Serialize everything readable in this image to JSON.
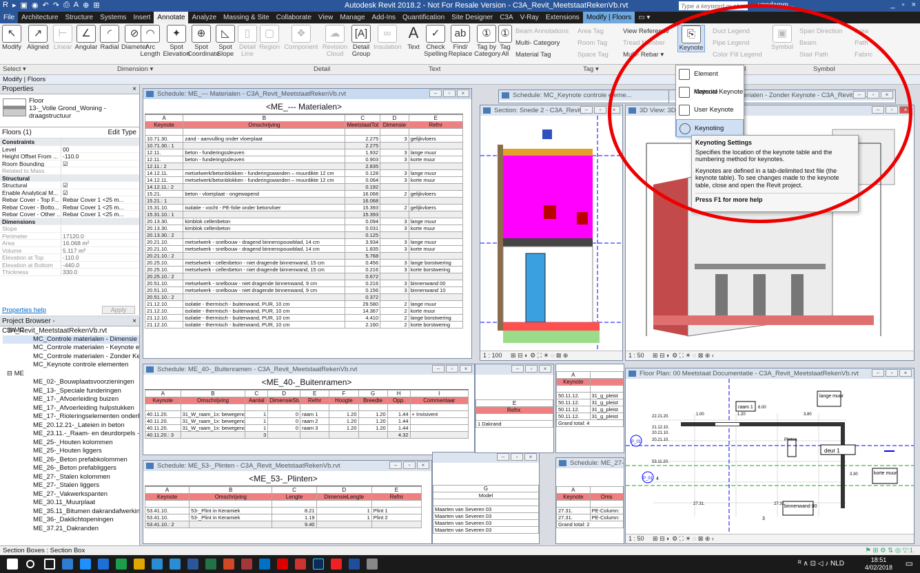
{
  "titlebar": {
    "title": "Autodesk Revit 2018.2 - Not For Resale Version -   C3A_Revit_MeetstaatRekenVb.rvt",
    "search_placeholder": "Type a keyword or phrase",
    "user": "vandamm...",
    "min": "_",
    "restore": "▫",
    "close": "×"
  },
  "tabs": [
    "File",
    "Architecture",
    "Structure",
    "Systems",
    "Insert",
    "Annotate",
    "Analyze",
    "Massing & Site",
    "Collaborate",
    "View",
    "Manage",
    "Add-Ins",
    "Quantification",
    "Site Designer",
    "C3A",
    "V-Ray",
    "Extensions",
    "Modify | Floors",
    "▭ ▾"
  ],
  "ribbon": {
    "modify": "Modify",
    "aligned": "Aligned",
    "linear": "Linear",
    "angular": "Angular",
    "radial": "Radial",
    "diameter": "Diameter",
    "arc_length": "Arc Length",
    "spot_elevation": "Spot Elevation",
    "spot_coordinate": "Spot Coordinate",
    "spot_slope": "Spot Slope",
    "detail_line": "Detail Line",
    "region": "Region",
    "component": "Component",
    "revision_cloud": "Revision Cloud",
    "detail_group": "Detail Group",
    "insulation": "Insulation",
    "text": "Text",
    "check_spelling": "Check Spelling",
    "find_replace": "Find/ Replace",
    "tag_by_category": "Tag by Category",
    "tag_all": "Tag All",
    "beam_annotations": "Beam Annotations",
    "multi_category": "Multi- Category",
    "material_tag": "Material Tag",
    "area_tag": "Area Tag",
    "room_tag": "Room Tag",
    "space_tag": "Space Tag",
    "view_reference": "View Reference",
    "tread_number": "Tread Number",
    "multi_rebar": "Multi- Rebar ▾",
    "keynote": "Keynote",
    "duct_legend": "Duct Legend",
    "pipe_legend": "Pipe Legend",
    "color_fill_legend": "Color Fill Legend",
    "symbol": "Symbol",
    "span_direction": "Span Direction",
    "beam": "Beam",
    "stair_path": "Stair Path",
    "area": "Area",
    "path": "Path",
    "fabric": "Fabric"
  },
  "ribbon_footer": {
    "select": "Select ▾",
    "dimension": "Dimension ▾",
    "detail": "Detail",
    "text": "Text",
    "tag": "Tag ▾",
    "fill": "ll",
    "symbol": "Symbol"
  },
  "context": "Modify | Floors",
  "properties": {
    "title": "Properties",
    "type_name": "Floor\n13-_Volle Grond_Woning - draagstructuur",
    "filter": "Floors (1)",
    "edit_type": "Edit Type",
    "rows": [
      {
        "k": "Constraints",
        "v": "",
        "g": true
      },
      {
        "k": "Level",
        "v": "00"
      },
      {
        "k": "Height Offset From ...",
        "v": "-110.0"
      },
      {
        "k": "Room Bounding",
        "v": "☑"
      },
      {
        "k": "Related to Mass",
        "v": "",
        "d": true
      },
      {
        "k": "Structural",
        "v": "",
        "g": true
      },
      {
        "k": "Structural",
        "v": "☑"
      },
      {
        "k": "Enable Analytical M...",
        "v": "☑"
      },
      {
        "k": "Rebar Cover - Top F...",
        "v": "Rebar Cover 1 <25 m..."
      },
      {
        "k": "Rebar Cover - Botto...",
        "v": "Rebar Cover 1 <25 m..."
      },
      {
        "k": "Rebar Cover - Other ...",
        "v": "Rebar Cover 1 <25 m..."
      },
      {
        "k": "Dimensions",
        "v": "",
        "g": true
      },
      {
        "k": "Slope",
        "v": "",
        "d": true
      },
      {
        "k": "Perimeter",
        "v": "17120.0",
        "d": true
      },
      {
        "k": "Area",
        "v": "16.068 m²",
        "d": true
      },
      {
        "k": "Volume",
        "v": "5.117 m³",
        "d": true
      },
      {
        "k": "Elevation at Top",
        "v": "-110.0",
        "d": true
      },
      {
        "k": "Elevation at Bottom",
        "v": "-440.0",
        "d": true
      },
      {
        "k": "Thickness",
        "v": "330.0",
        "d": true
      }
    ],
    "help": "Properties help",
    "apply": "Apply"
  },
  "browser": {
    "title": "Project Browser - C3A_Revit_MeetstaatRekenVb.rvt",
    "items": [
      {
        "t": "⊟ MC",
        "l": 1
      },
      {
        "t": "MC_Controle materialen - Dimensie",
        "l": 2,
        "sel": true
      },
      {
        "t": "MC_Controle materialen - Keynote en",
        "l": 2
      },
      {
        "t": "MC_Controle materialen - Zonder Keyr",
        "l": 2
      },
      {
        "t": "MC_Keynote controle elementen",
        "l": 2
      },
      {
        "t": "⊟ ME",
        "l": 1
      },
      {
        "t": "ME_02-_Bouwplaatsvoorzieningen",
        "l": 2
      },
      {
        "t": "ME_13-_Speciale funderingen",
        "l": 2
      },
      {
        "t": "ME_17-_Afvoerleiding buizen",
        "l": 2
      },
      {
        "t": "ME_17-_Afvoerleiding hulpstukken",
        "l": 2
      },
      {
        "t": "ME_17-_Rioleringselementen onderbo",
        "l": 2
      },
      {
        "t": "ME_20.12.21-_Lateien in beton",
        "l": 2
      },
      {
        "t": "ME_23.11.-_Raam- en deurdorpels - b",
        "l": 2
      },
      {
        "t": "ME_25-_Houten kolommen",
        "l": 2
      },
      {
        "t": "ME_25-_Houten liggers",
        "l": 2
      },
      {
        "t": "ME_26-_Beton prefabkolommen",
        "l": 2
      },
      {
        "t": "ME_26-_Beton prefabliggers",
        "l": 2
      },
      {
        "t": "ME_27-_Stalen kolommen",
        "l": 2
      },
      {
        "t": "ME_27-_Stalen liggers",
        "l": 2
      },
      {
        "t": "ME_27-_Vakwerkspanten",
        "l": 2
      },
      {
        "t": "ME_30.11_Muurplaat",
        "l": 2
      },
      {
        "t": "ME_35.11_Bitumen dakrandafwerkin",
        "l": 2
      },
      {
        "t": "ME_36-_Daklichtopeningen",
        "l": 2
      },
      {
        "t": "ME_37.21_Dakranden",
        "l": 2
      }
    ]
  },
  "sched_mat": {
    "tab": "Schedule: ME_--- Materialen - C3A_Revit_MeetstaatRekenVb.rvt",
    "title": "<ME_--- Materialen>",
    "letters": [
      "A",
      "B",
      "C",
      "D",
      "E"
    ],
    "headers": [
      "Keynote",
      "Omschrijving",
      "MeetstaatTot",
      "Dimensie",
      "Refnr"
    ],
    "rows": [
      [
        "",
        "",
        "",
        "",
        ""
      ],
      [
        "10.71.30.",
        "zand - aanvulling onder vloerplaat",
        "2.275",
        "3",
        "gelijkvloers"
      ],
      [
        "10.71.30.: 1",
        "",
        "2.275",
        "",
        ""
      ],
      [
        "12.11.",
        "beton - funderingssleuven",
        "1.932",
        "3",
        "lange muur"
      ],
      [
        "12.11.",
        "beton - funderingssleuven",
        "0.903",
        "3",
        "korte muur"
      ],
      [
        "12.11.: 2",
        "",
        "2.835",
        "",
        ""
      ],
      [
        "14.12.11.",
        "metselwerk/betonblokken - funderingswanden – muurdikte 12 cm",
        "0.128",
        "3",
        "lange muur"
      ],
      [
        "14.12.11.",
        "metselwerk/betonblokken - funderingswanden – muurdikte 12 cm",
        "0.064",
        "3",
        "korte muur"
      ],
      [
        "14.12.11.: 2",
        "",
        "0.192",
        "",
        ""
      ],
      [
        "15.21.",
        "beton - vloerplaat - ongewapend",
        "16.068",
        "2",
        "gelijkvloers"
      ],
      [
        "15.21.: 1",
        "",
        "16.068",
        "",
        ""
      ],
      [
        "15.31.10.",
        "isolatie - vocht - PE-folie onder betonvloer",
        "15.393",
        "2",
        "gelijkvloers"
      ],
      [
        "15.31.10.: 1",
        "",
        "15.393",
        "",
        ""
      ],
      [
        "20.13.30.",
        "kimblok cellenbeton",
        "0.094",
        "3",
        "lange muur"
      ],
      [
        "20.13.30.",
        "kimblok cellenbeton",
        "0.031",
        "3",
        "korte muur"
      ],
      [
        "20.13.30.: 2",
        "",
        "0.125",
        "",
        ""
      ],
      [
        "20.21.10.",
        "metselwerk - snelbouw - dragend binnenspouwblad, 14 cm",
        "3.934",
        "3",
        "lange muur"
      ],
      [
        "20.21.10.",
        "metselwerk - snelbouw - dragend binnenspouwblad, 14 cm",
        "1.835",
        "3",
        "korte muur"
      ],
      [
        "20.21.10.: 2",
        "",
        "5.768",
        "",
        ""
      ],
      [
        "20.25.10.",
        "metselwerk - cellenbeton - niet dragende binnenwand, 15 cm",
        "0.456",
        "3",
        "lange borstwering"
      ],
      [
        "20.25.10.",
        "metselwerk - cellenbeton - niet dragende binnenwand, 15 cm",
        "0.216",
        "3",
        "korte borstwering"
      ],
      [
        "20.25.10.: 2",
        "",
        "0.672",
        "",
        ""
      ],
      [
        "20.51.10.",
        "metselwerk - snelbouw - niet dragende binnenwand, 9 cm",
        "0.216",
        "3",
        "binnenwand 00"
      ],
      [
        "20.51.10.",
        "metselwerk - snelbouw - niet dragende binnenwand, 9 cm",
        "0.156",
        "3",
        "binnenwand 10"
      ],
      [
        "20.51.10.: 2",
        "",
        "0.372",
        "",
        ""
      ],
      [
        "21.12.10.",
        "isolatie - thermisch - buitenwand, PUR, 10 cm",
        "29.580",
        "2",
        "lange muur"
      ],
      [
        "21.12.10.",
        "isolatie - thermisch - buitenwand, PUR, 10 cm",
        "14.367",
        "2",
        "korte muur"
      ],
      [
        "21.12.10.",
        "isolatie - thermisch - buitenwand, PUR, 10 cm",
        "4.410",
        "2",
        "lange borstwering"
      ],
      [
        "21.12.10.",
        "isolatie - thermisch - buitenwand, PUR, 10 cm",
        "2.160",
        "2",
        "korte borstwering"
      ]
    ]
  },
  "sched_ramen": {
    "tab": "Schedule: ME_40-_Buitenramen - C3A_Revit_MeetstaatRekenVb.rvt",
    "title": "<ME_40-_Buitenramen>",
    "letters": [
      "A",
      "B",
      "C",
      "D",
      "E",
      "F",
      "G",
      "H",
      "I"
    ],
    "headers": [
      "Keynote",
      "Omschrijving",
      "Aantal",
      "DimensieStuk",
      "Refnr",
      "Hoogte",
      "Breedte",
      "Opp.",
      "Commentaar"
    ],
    "rows": [
      [
        "",
        "",
        "",
        "",
        "",
        "",
        "",
        "",
        ""
      ],
      [
        "40.11.20.",
        "31_W_raam_1x: bewegend",
        "1",
        "0",
        "raam 1",
        "1.20",
        "1.20",
        "1.44",
        "+ Invisivent"
      ],
      [
        "40.11.20.",
        "31_W_raam_1x: bewegend",
        "1",
        "0",
        "raam 2",
        "1.20",
        "1.20",
        "1.44",
        ""
      ],
      [
        "40.11.20.",
        "31_W_raam_1x: bewegend",
        "1",
        "0",
        "raam 3",
        "1.20",
        "1.20",
        "1.44",
        ""
      ],
      [
        "40.11.20.: 3",
        "",
        "3",
        "",
        "",
        "",
        "",
        "4.32",
        ""
      ]
    ]
  },
  "sched_plint": {
    "tab": "Schedule: ME_53-_Plinten - C3A_Revit_MeetstaatRekenVb.rvt",
    "title": "<ME_53-_Plinten>",
    "letters": [
      "A",
      "B",
      "C",
      "D",
      "E"
    ],
    "headers": [
      "Keynote",
      "Omschrijving",
      "Lengte",
      "DimensieLengte",
      "Refnr"
    ],
    "rows": [
      [
        "",
        "",
        "",
        "",
        ""
      ],
      [
        "53.41.10.",
        "53-_Plint in Keramiek",
        "8.21",
        "1",
        "Plint 1"
      ],
      [
        "53.41.10.",
        "53-_Plint in Keramiek",
        "1.19",
        "1",
        "Plint 2"
      ],
      [
        "53.41.10.: 2",
        "",
        "9.40",
        "",
        ""
      ]
    ]
  },
  "section": {
    "tab": "Section: Snede 2 - C3A_Revit_...",
    "scale": "1 : 100"
  },
  "view3d": {
    "tab": "3D View: 3D Bin...staatRekenVb.rvt",
    "scale": "1 : 50"
  },
  "keynote_sched": {
    "tab": "Schedule: MC_Keynote controle eleme..."
  },
  "zonder": {
    "tab": "aterialen - Zonder Keynote - C3A_Revit_Me..."
  },
  "floorplan": {
    "tab": "Floor Plan: 00 Meetstaat Documentatie - C3A_Revit_MeetstaatRekenVb.rvt",
    "scale": "1 : 50",
    "labels": {
      "raam": "raam 1",
      "lange": "lange muur",
      "korte": "korte muur",
      "deur": "deur 1",
      "plinten": "Plinten",
      "binnen": "binnenwand 00",
      "l1": "22.21.20.",
      "l2": "21.12.10.",
      "l3": "20.21.10.",
      "l4": "53.11.20.",
      "l5": "27.31.",
      "l6": "27.31.",
      "d1": "1.00",
      "d2": "1.20",
      "d3": "3.80",
      "d4": "6.00",
      "d5": "3.30",
      "p1": "P_01",
      "p2": "P_01",
      "n4": "4",
      "n3": "3"
    }
  },
  "mid_sched": {
    "letters": [
      "A",
      "E"
    ],
    "keynote": "Keynote",
    "refnr": "Refnr.",
    "dakrand": "1 Dakrand",
    "rows": [
      [
        "50.11.12.",
        "31_g_pleist"
      ],
      [
        "50.11.12.",
        "31_g_pleist"
      ],
      [
        "50.11.12.",
        "31_g_pleist"
      ],
      [
        "50.11.12.",
        "31_g_pleist"
      ]
    ],
    "total": "Grand total: 4"
  },
  "model_sched": {
    "letter": "G",
    "header": "Model",
    "rows": [
      "Maarten van Severen 03",
      "Maarten van Severen 03",
      "Maarten van Severen 03",
      "Maarten van Severen 03"
    ]
  },
  "stal_sched": {
    "tab": "Schedule: ME_27-_Sta",
    "letter": "A",
    "h1": "Keynote",
    "h2": "Oms",
    "rows": [
      [
        "27.31.",
        "PE-Column:"
      ],
      [
        "27.31.",
        "PE-Column:"
      ]
    ],
    "total": "Grand total: 2"
  },
  "dropdown": {
    "items": [
      "Element Keynote",
      "Material Keynote",
      "User Keynote",
      "Keynoting Settings"
    ]
  },
  "tooltip": {
    "title": "Keynoting Settings",
    "p1": "Specifies the location of the keynote table and the numbering method for keynotes.",
    "p2": "Keynotes are defined in a tab-delimited text file (the keynote table). To see changes made to the keynote table, close and open the Revit project.",
    "f1": "Press F1 for more help"
  },
  "statusbar": "Section Boxes : Section Box",
  "taskbar": {
    "lang": "NLD",
    "time": "18:51",
    "date": "4/02/2018"
  },
  "colors": {
    "accent": "#2b579a",
    "header": "#f08080",
    "magenta": "#ff00ff",
    "red_circle": "#e00000"
  }
}
